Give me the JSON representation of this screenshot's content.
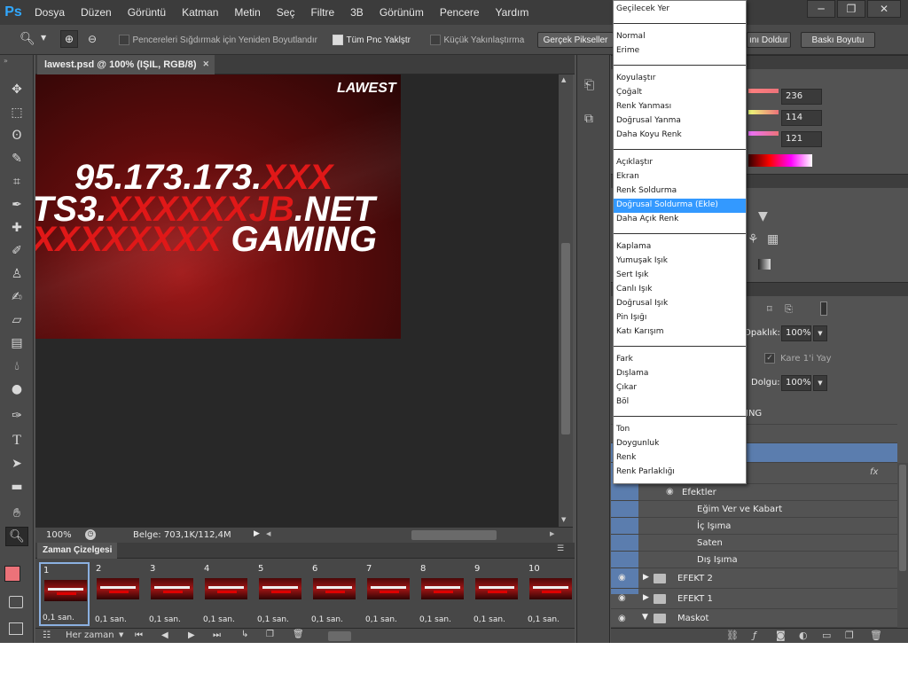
{
  "app": {
    "logo": "Ps"
  },
  "menubar": {
    "items": [
      "Dosya",
      "Düzen",
      "Görüntü",
      "Katman",
      "Metin",
      "Seç",
      "Filtre",
      "3B",
      "Görünüm",
      "Pencere",
      "Yardım"
    ]
  },
  "window_controls": {
    "minimize": "─",
    "restore": "❐",
    "close": "✕"
  },
  "options": {
    "resize_windows_label": "Pencereleri Sığdırmak için Yeniden Boyutlandır",
    "zoom_all_label": "Tüm Pnc Yaklştr",
    "scrubby_label": "Küçük Yakınlaştırma",
    "actual_pixels": "Gerçek Pikseller",
    "fill_screen": "ını Doldur",
    "print_size": "Baskı Boyutu"
  },
  "document": {
    "tab_title": "lawest.psd @ 100% (IŞIL, RGB/8)",
    "tab_close": "✕",
    "zoom": "100%",
    "doc_info": "Belge: 703,1K/112,4M"
  },
  "artwork": {
    "logo": "LAWEST",
    "line1_white": "95.173.173.",
    "line1_red": "XXX",
    "line2_white_a": "TS3.",
    "line2_red": "XXXXXXJB",
    "line2_white_b": ".NET",
    "line3_red": "XXXXXXXX",
    "line3_white": " GAMING"
  },
  "timeline": {
    "tab_label": "Zaman Çizelgesi",
    "frames": [
      {
        "num": "1",
        "delay": "0,1 san."
      },
      {
        "num": "2",
        "delay": "0,1 san."
      },
      {
        "num": "3",
        "delay": "0,1 san."
      },
      {
        "num": "4",
        "delay": "0,1 san."
      },
      {
        "num": "5",
        "delay": "0,1 san."
      },
      {
        "num": "6",
        "delay": "0,1 san."
      },
      {
        "num": "7",
        "delay": "0,1 san."
      },
      {
        "num": "8",
        "delay": "0,1 san."
      },
      {
        "num": "9",
        "delay": "0,1 san."
      },
      {
        "num": "10",
        "delay": "0,1 san."
      }
    ],
    "loop": "Her zaman"
  },
  "color_panel": {
    "r": "236",
    "g": "114",
    "b": "121",
    "fg_color": "#ec7279"
  },
  "layers": {
    "opacity_label": "Opaklık:",
    "opacity_value": "100%",
    "lock_frame_label": "Kare 1'i Yay",
    "fill_label": "Dolgu:",
    "fill_value": "100%",
    "partial_layer": "ING",
    "fx": "fx",
    "effects_label": "Efektler",
    "effects": [
      "Eğim Ver ve Kabart",
      "İç Işıma",
      "Saten",
      "Dış Işıma"
    ],
    "groups": [
      "EFEKT 2",
      "EFEKT 1",
      "Maskot"
    ]
  },
  "blend_modes": {
    "groups": [
      [
        "Geçilecek Yer"
      ],
      [
        "Normal",
        "Erime"
      ],
      [
        "Koyulaştır",
        "Çoğalt",
        "Renk Yanması",
        "Doğrusal Yanma",
        "Daha Koyu Renk"
      ],
      [
        "Açıklaştır",
        "Ekran",
        "Renk Soldurma",
        "Doğrusal Soldurma (Ekle)",
        "Daha Açık Renk"
      ],
      [
        "Kaplama",
        "Yumuşak Işık",
        "Sert Işık",
        "Canlı Işık",
        "Doğrusal Işık",
        "Pin Işığı",
        "Katı Karışım"
      ],
      [
        "Fark",
        "Dışlama",
        "Çıkar",
        "Böl"
      ],
      [
        "Ton",
        "Doygunluk",
        "Renk",
        "Renk Parlaklığı"
      ]
    ],
    "highlighted": "Doğrusal Soldurma (Ekle)"
  }
}
